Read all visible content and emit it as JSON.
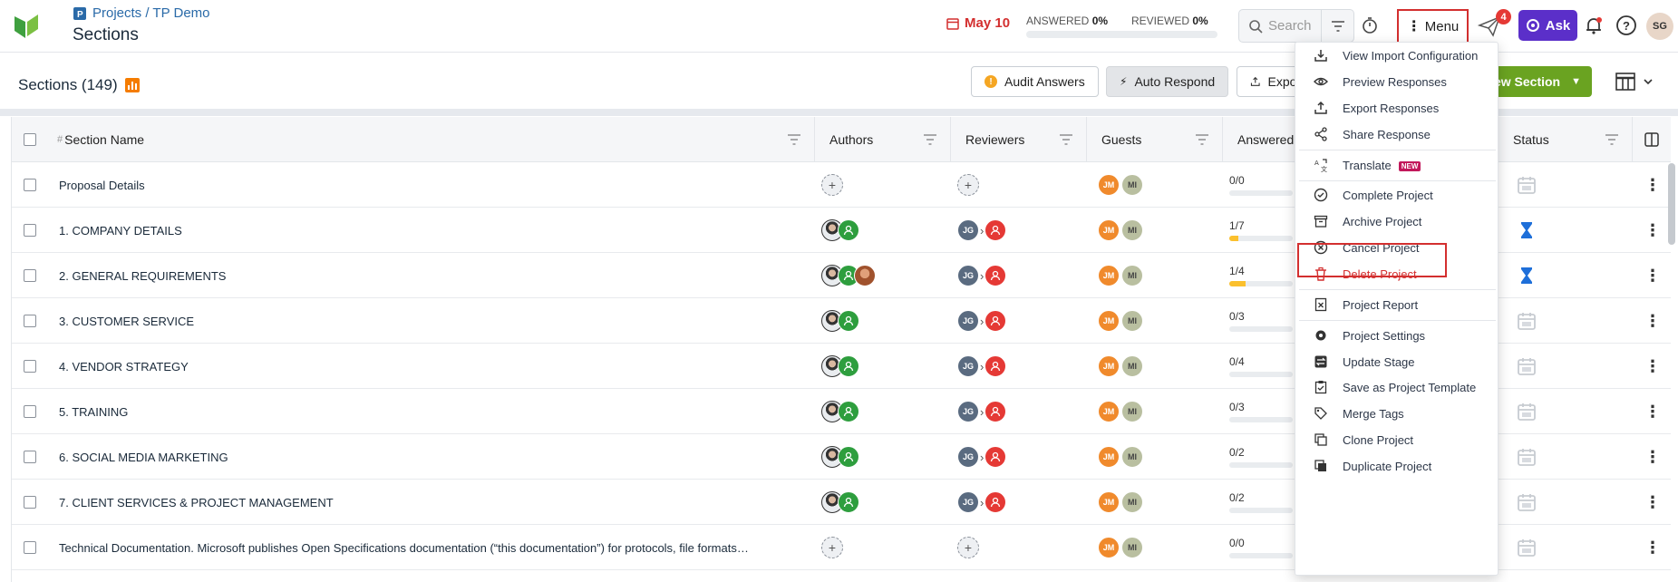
{
  "header": {
    "breadcrumb": "Projects / TP Demo",
    "page_title": "Sections",
    "date": "May 10",
    "answered_label": "ANSWERED",
    "answered_pct": "0%",
    "reviewed_label": "REVIEWED",
    "reviewed_pct": "0%",
    "search_placeholder": "Search",
    "menu_label": "Menu",
    "notification_count": "4",
    "ask_label": "Ask",
    "user_initials": "SG"
  },
  "subheader": {
    "title": "Sections (149)",
    "audit_label": "Audit Answers",
    "auto_label": "Auto Respond",
    "export_label": "Export",
    "new_section_label": "New Section"
  },
  "table": {
    "columns": {
      "hash": "#",
      "section_name": "Section Name",
      "authors": "Authors",
      "reviewers": "Reviewers",
      "guests": "Guests",
      "answered": "Answered",
      "status": "Status"
    },
    "rows": [
      {
        "name": "Proposal Details",
        "authors": "none",
        "reviewers": "none",
        "answered": "0/0",
        "fill": 0,
        "status": "calendar"
      },
      {
        "name": "1. COMPANY DETAILS",
        "authors": "two",
        "reviewers": "assigned",
        "answered": "1/7",
        "fill": 0.14,
        "status": "hourglass"
      },
      {
        "name": "2. GENERAL REQUIREMENTS",
        "authors": "three",
        "reviewers": "assigned",
        "answered": "1/4",
        "fill": 0.25,
        "status": "hourglass"
      },
      {
        "name": "3. CUSTOMER SERVICE",
        "authors": "two",
        "reviewers": "assigned",
        "answered": "0/3",
        "fill": 0,
        "status": "calendar"
      },
      {
        "name": "4. VENDOR STRATEGY",
        "authors": "two",
        "reviewers": "assigned",
        "answered": "0/4",
        "fill": 0,
        "status": "calendar"
      },
      {
        "name": "5. TRAINING",
        "authors": "two",
        "reviewers": "assigned",
        "answered": "0/3",
        "fill": 0,
        "status": "calendar"
      },
      {
        "name": "6. SOCIAL MEDIA MARKETING",
        "authors": "two",
        "reviewers": "assigned",
        "answered": "0/2",
        "fill": 0,
        "status": "calendar"
      },
      {
        "name": "7. CLIENT SERVICES & PROJECT MANAGEMENT",
        "authors": "two",
        "reviewers": "assigned",
        "answered": "0/2",
        "fill": 0,
        "status": "calendar"
      },
      {
        "name": "Technical Documentation. Microsoft publishes Open Specifications documentation (“this documentation”) for protocols, file formats…",
        "authors": "none",
        "reviewers": "none",
        "answered": "0/0",
        "fill": 0,
        "status": "calendar"
      }
    ],
    "reviewer_initials": "JG",
    "guest_initials": [
      "JM",
      "MI"
    ]
  },
  "menu": {
    "items": [
      {
        "label": "View Import Configuration",
        "icon": "download-icon"
      },
      {
        "label": "Preview Responses",
        "icon": "eye-icon"
      },
      {
        "label": "Export Responses",
        "icon": "upload-icon"
      },
      {
        "label": "Share Response",
        "icon": "share-icon"
      },
      {
        "label": "Translate",
        "icon": "translate-icon",
        "tag": "NEW"
      },
      {
        "label": "Complete Project",
        "icon": "check-circle-icon"
      },
      {
        "label": "Archive Project",
        "icon": "archive-icon"
      },
      {
        "label": "Cancel Project",
        "icon": "x-circle-icon"
      },
      {
        "label": "Delete Project",
        "icon": "trash-icon"
      },
      {
        "label": "Project Report",
        "icon": "report-icon"
      },
      {
        "label": "Project Settings",
        "icon": "settings-icon"
      },
      {
        "label": "Update Stage",
        "icon": "stage-icon"
      },
      {
        "label": "Save as Project Template",
        "icon": "template-icon"
      },
      {
        "label": "Merge Tags",
        "icon": "tag-icon"
      },
      {
        "label": "Clone Project",
        "icon": "clone-icon"
      },
      {
        "label": "Duplicate Project",
        "icon": "duplicate-icon"
      }
    ]
  },
  "colors": {
    "brand_green": "#6aa321",
    "ask_purple": "#5b2fc9",
    "highlight_red": "#d32f2f"
  }
}
